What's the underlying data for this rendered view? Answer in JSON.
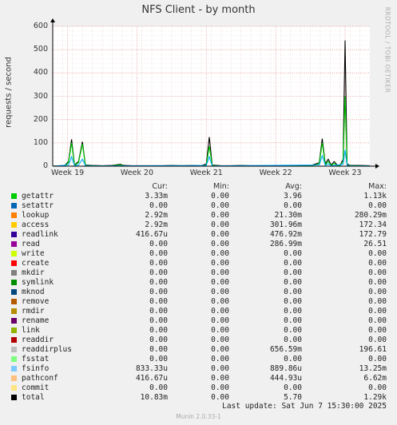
{
  "title": "NFS Client - by month",
  "ylabel": "requests / second",
  "watermark": "RRDTOOL / TOBI OETIKER",
  "chart_data": {
    "type": "line",
    "title": "NFS Client - by month",
    "ylabel": "requests / second",
    "ylim": [
      0,
      600
    ],
    "yticks": [
      "0",
      "100",
      "200",
      "300",
      "400",
      "500",
      "600"
    ],
    "xticks": [
      "Week 19",
      "Week 20",
      "Week 21",
      "Week 22",
      "Week 23"
    ],
    "xlim_days": [
      0,
      32
    ],
    "grid": true,
    "series": [
      {
        "name": "total",
        "color": "#000000",
        "points": [
          [
            0,
            0
          ],
          [
            1.2,
            3
          ],
          [
            1.6,
            20
          ],
          [
            1.9,
            115
          ],
          [
            2.2,
            5
          ],
          [
            2.6,
            20
          ],
          [
            3.0,
            105
          ],
          [
            3.3,
            5
          ],
          [
            4,
            3
          ],
          [
            5,
            2
          ],
          [
            6,
            3
          ],
          [
            6.8,
            8
          ],
          [
            7.2,
            3
          ],
          [
            8,
            2
          ],
          [
            9,
            2
          ],
          [
            10,
            2
          ],
          [
            11,
            2
          ],
          [
            12,
            3
          ],
          [
            13,
            2
          ],
          [
            14,
            3
          ],
          [
            15,
            2
          ],
          [
            15.5,
            10
          ],
          [
            15.8,
            125
          ],
          [
            16.1,
            5
          ],
          [
            17,
            2
          ],
          [
            18,
            2
          ],
          [
            19,
            3
          ],
          [
            20,
            2
          ],
          [
            21,
            2
          ],
          [
            22,
            2
          ],
          [
            23,
            2
          ],
          [
            24,
            3
          ],
          [
            25,
            2
          ],
          [
            26,
            2
          ],
          [
            26.9,
            15
          ],
          [
            27.2,
            118
          ],
          [
            27.5,
            10
          ],
          [
            27.8,
            30
          ],
          [
            28.1,
            5
          ],
          [
            28.4,
            20
          ],
          [
            28.7,
            5
          ],
          [
            29.0,
            3
          ],
          [
            29.3,
            30
          ],
          [
            29.5,
            540
          ],
          [
            29.7,
            10
          ],
          [
            30,
            3
          ],
          [
            31,
            3
          ],
          [
            32,
            2
          ]
        ]
      },
      {
        "name": "getattr",
        "color": "#00cc00",
        "points": [
          [
            0,
            0
          ],
          [
            1.2,
            2
          ],
          [
            1.6,
            15
          ],
          [
            1.9,
            100
          ],
          [
            2.2,
            3
          ],
          [
            2.6,
            15
          ],
          [
            3.0,
            95
          ],
          [
            3.3,
            3
          ],
          [
            4,
            2
          ],
          [
            5,
            1
          ],
          [
            6,
            2
          ],
          [
            6.8,
            5
          ],
          [
            7.2,
            2
          ],
          [
            8,
            1
          ],
          [
            9,
            1
          ],
          [
            10,
            1
          ],
          [
            11,
            1
          ],
          [
            12,
            2
          ],
          [
            13,
            1
          ],
          [
            14,
            2
          ],
          [
            15,
            1
          ],
          [
            15.5,
            5
          ],
          [
            15.8,
            85
          ],
          [
            16.1,
            3
          ],
          [
            17,
            1
          ],
          [
            18,
            1
          ],
          [
            19,
            2
          ],
          [
            20,
            1
          ],
          [
            21,
            1
          ],
          [
            22,
            1
          ],
          [
            23,
            1
          ],
          [
            24,
            2
          ],
          [
            25,
            1
          ],
          [
            26,
            1
          ],
          [
            26.9,
            10
          ],
          [
            27.2,
            100
          ],
          [
            27.5,
            5
          ],
          [
            27.8,
            20
          ],
          [
            28.1,
            3
          ],
          [
            28.4,
            12
          ],
          [
            28.7,
            3
          ],
          [
            29.0,
            2
          ],
          [
            29.3,
            20
          ],
          [
            29.5,
            300
          ],
          [
            29.7,
            5
          ],
          [
            30,
            2
          ],
          [
            31,
            2
          ],
          [
            32,
            1
          ]
        ]
      },
      {
        "name": "fsinfo",
        "color": "#00aaff",
        "points": [
          [
            0,
            0
          ],
          [
            1.6,
            5
          ],
          [
            1.9,
            40
          ],
          [
            2.2,
            2
          ],
          [
            2.6,
            5
          ],
          [
            3.0,
            30
          ],
          [
            3.3,
            2
          ],
          [
            4,
            1
          ],
          [
            15.5,
            3
          ],
          [
            15.8,
            40
          ],
          [
            16.1,
            1
          ],
          [
            26.9,
            5
          ],
          [
            27.2,
            45
          ],
          [
            27.5,
            3
          ],
          [
            27.8,
            10
          ],
          [
            28.1,
            2
          ],
          [
            29.3,
            8
          ],
          [
            29.5,
            70
          ],
          [
            29.7,
            3
          ],
          [
            30,
            1
          ],
          [
            32,
            1
          ]
        ]
      }
    ],
    "legend_columns": [
      "Cur:",
      "Min:",
      "Avg:",
      "Max:"
    ],
    "legend": [
      {
        "name": "getattr",
        "color": "#00cc00",
        "cur": "3.33m",
        "min": "0.00",
        "avg": "3.96",
        "max": "1.13k"
      },
      {
        "name": "setattr",
        "color": "#0066b3",
        "cur": "0.00",
        "min": "0.00",
        "avg": "0.00",
        "max": "0.00"
      },
      {
        "name": "lookup",
        "color": "#ff8000",
        "cur": "2.92m",
        "min": "0.00",
        "avg": "21.30m",
        "max": "280.29m"
      },
      {
        "name": "access",
        "color": "#ffcc00",
        "cur": "2.92m",
        "min": "0.00",
        "avg": "301.96m",
        "max": "172.34"
      },
      {
        "name": "readlink",
        "color": "#330099",
        "cur": "416.67u",
        "min": "0.00",
        "avg": "476.92m",
        "max": "172.79"
      },
      {
        "name": "read",
        "color": "#990099",
        "cur": "0.00",
        "min": "0.00",
        "avg": "286.99m",
        "max": "26.51"
      },
      {
        "name": "write",
        "color": "#ccff00",
        "cur": "0.00",
        "min": "0.00",
        "avg": "0.00",
        "max": "0.00"
      },
      {
        "name": "create",
        "color": "#ff0000",
        "cur": "0.00",
        "min": "0.00",
        "avg": "0.00",
        "max": "0.00"
      },
      {
        "name": "mkdir",
        "color": "#808080",
        "cur": "0.00",
        "min": "0.00",
        "avg": "0.00",
        "max": "0.00"
      },
      {
        "name": "symlink",
        "color": "#008f00",
        "cur": "0.00",
        "min": "0.00",
        "avg": "0.00",
        "max": "0.00"
      },
      {
        "name": "mknod",
        "color": "#00487d",
        "cur": "0.00",
        "min": "0.00",
        "avg": "0.00",
        "max": "0.00"
      },
      {
        "name": "remove",
        "color": "#b35a00",
        "cur": "0.00",
        "min": "0.00",
        "avg": "0.00",
        "max": "0.00"
      },
      {
        "name": "rmdir",
        "color": "#b38f00",
        "cur": "0.00",
        "min": "0.00",
        "avg": "0.00",
        "max": "0.00"
      },
      {
        "name": "rename",
        "color": "#6b006b",
        "cur": "0.00",
        "min": "0.00",
        "avg": "0.00",
        "max": "0.00"
      },
      {
        "name": "link",
        "color": "#8fb300",
        "cur": "0.00",
        "min": "0.00",
        "avg": "0.00",
        "max": "0.00"
      },
      {
        "name": "readdir",
        "color": "#b30000",
        "cur": "0.00",
        "min": "0.00",
        "avg": "0.00",
        "max": "0.00"
      },
      {
        "name": "readdirplus",
        "color": "#bebebe",
        "cur": "0.00",
        "min": "0.00",
        "avg": "656.59m",
        "max": "196.61"
      },
      {
        "name": "fsstat",
        "color": "#80ff80",
        "cur": "0.00",
        "min": "0.00",
        "avg": "0.00",
        "max": "0.00"
      },
      {
        "name": "fsinfo",
        "color": "#80c9ff",
        "cur": "833.33u",
        "min": "0.00",
        "avg": "889.86u",
        "max": "13.25m"
      },
      {
        "name": "pathconf",
        "color": "#ffc080",
        "cur": "416.67u",
        "min": "0.00",
        "avg": "444.93u",
        "max": "6.62m"
      },
      {
        "name": "commit",
        "color": "#ffe680",
        "cur": "0.00",
        "min": "0.00",
        "avg": "0.00",
        "max": "0.00"
      },
      {
        "name": "total",
        "color": "#000000",
        "cur": "10.83m",
        "min": "0.00",
        "avg": "5.70",
        "max": "1.29k"
      }
    ]
  },
  "last_update": "Last update:  Sat Jun  7 15:30:00 2025",
  "footer": "Munin 2.0.33-1"
}
